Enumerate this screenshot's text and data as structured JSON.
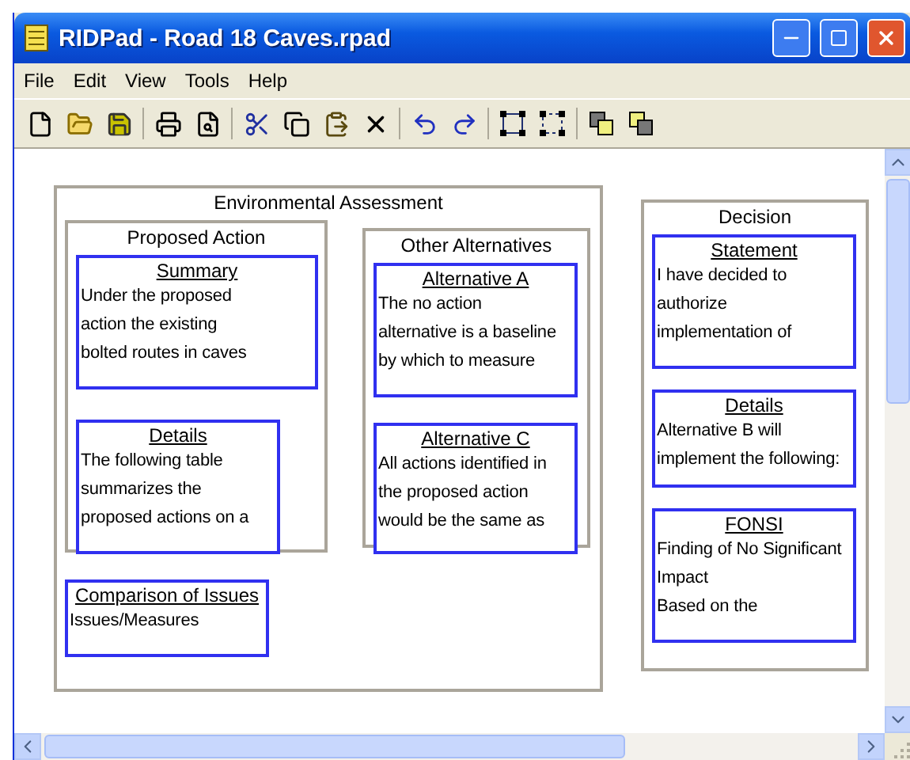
{
  "window": {
    "title": "RIDPad - Road 18 Caves.rpad"
  },
  "menu": [
    "File",
    "Edit",
    "View",
    "Tools",
    "Help"
  ],
  "toolbar": [
    {
      "kind": "new"
    },
    {
      "kind": "open"
    },
    {
      "kind": "save"
    },
    {
      "kind": "sep"
    },
    {
      "kind": "print"
    },
    {
      "kind": "preview"
    },
    {
      "kind": "sep"
    },
    {
      "kind": "cut"
    },
    {
      "kind": "copy"
    },
    {
      "kind": "paste"
    },
    {
      "kind": "delete"
    },
    {
      "kind": "sep"
    },
    {
      "kind": "undo"
    },
    {
      "kind": "redo"
    },
    {
      "kind": "sep"
    },
    {
      "kind": "group"
    },
    {
      "kind": "ungroup"
    },
    {
      "kind": "sep"
    },
    {
      "kind": "front"
    },
    {
      "kind": "back"
    }
  ],
  "canvas": {
    "assessment": {
      "title": "Environmental Assessment",
      "proposed": {
        "title": "Proposed Action",
        "notes": [
          {
            "title": "Summary",
            "body": "Under the proposed\naction the existing\nbolted routes in caves"
          },
          {
            "title": "Details",
            "body": "The following table\nsummarizes the\nproposed actions on a"
          }
        ]
      },
      "alternatives": {
        "title": "Other Alternatives",
        "notes": [
          {
            "title": "Alternative A",
            "body": "The no action\nalternative is a baseline\nby which to measure"
          },
          {
            "title": "Alternative C",
            "body": "All actions identified in\nthe proposed action\nwould be the same as"
          }
        ]
      },
      "comparison": {
        "title": "Comparison of Issues",
        "body": "Issues/Measures"
      }
    },
    "decision": {
      "title": "Decision",
      "notes": [
        {
          "title": "Statement",
          "body": "I have decided to\nauthorize\nimplementation of"
        },
        {
          "title": "Details",
          "body": "Alternative B will\nimplement the following:"
        },
        {
          "title": "FONSI",
          "body": "Finding of No Significant\nImpact\nBased on the"
        }
      ]
    }
  }
}
